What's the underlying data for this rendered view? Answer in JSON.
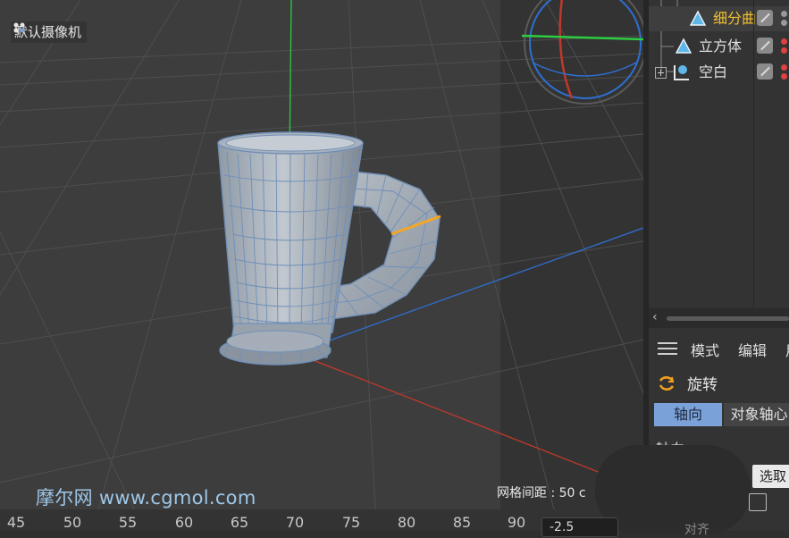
{
  "viewport": {
    "camera_label": "默认摄像机",
    "grid_spacing": "网格间距 : 50 c",
    "watermark": "摩尔网 www.cgmol.com"
  },
  "timeline": {
    "ticks": [
      "45",
      "50",
      "55",
      "60",
      "65",
      "70",
      "75",
      "80",
      "85",
      "90"
    ],
    "frame_value": "-2.5"
  },
  "object_manager": {
    "items": [
      {
        "label": "细分曲",
        "color": "#f0c030"
      },
      {
        "label": "立方体",
        "color": "#e0e0e0"
      },
      {
        "label": "空白",
        "color": "#e0e0e0"
      }
    ]
  },
  "attribute_manager": {
    "menu": [
      "模式",
      "编辑",
      "用"
    ],
    "rotate_label": "旋转",
    "tabs": [
      "轴向",
      "对象轴心"
    ],
    "section_label": "轴向",
    "select_button": "选取",
    "bottom_label": "对齐"
  },
  "colors": {
    "accent_tab": "#7ba1d9",
    "selected_object": "#f0c030",
    "axis_x": "#c0392b",
    "axis_y": "#2ecc40",
    "axis_z": "#2e6fd1",
    "wire": "#6f8fb8",
    "edge_selection": "#f5a623"
  }
}
